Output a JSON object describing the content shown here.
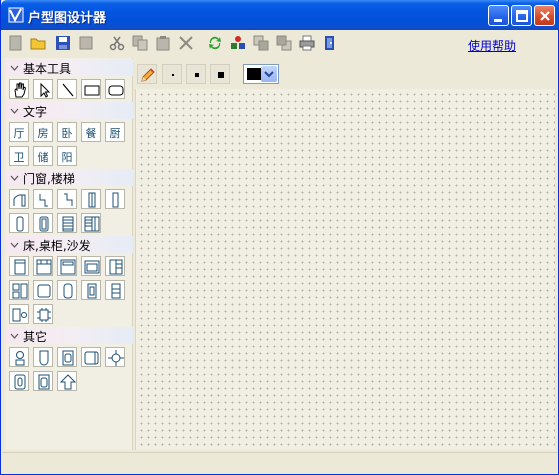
{
  "window": {
    "title": "户型图设计器"
  },
  "toolbar": {
    "buttons": [
      "new",
      "open",
      "save",
      "fullscreen",
      "cut",
      "copy",
      "paste",
      "delete",
      "refresh",
      "group",
      "bring-forward",
      "send-backward",
      "print",
      "exit"
    ],
    "help_label": "使用帮助"
  },
  "sidebar": {
    "sections": [
      {
        "title": "基本工具",
        "items": [
          "hand-icon",
          "pointer-icon",
          "line-icon",
          "rectangle-icon",
          "rounded-rectangle-icon"
        ]
      },
      {
        "title": "文字",
        "items": [
          "厅",
          "房",
          "卧",
          "餐",
          "厨",
          "卫",
          "储",
          "阳"
        ]
      },
      {
        "title": "门窗,楼梯",
        "items": [
          "door-icon",
          "door-left-icon",
          "door-right-icon",
          "window-icon",
          "window-thin-icon",
          "column-icon",
          "double-column-icon",
          "stairs-icon",
          "stairs-square-icon"
        ]
      },
      {
        "title": "床,桌柜,沙发",
        "items": [
          "cabinet-icon",
          "bed-icon",
          "sofa-icon",
          "wardrobe-icon",
          "bookshelf-icon",
          "drawer-icon",
          "table-icon",
          "chair-icon",
          "nightstand-icon",
          "shelf-icon",
          "dining-set-icon",
          "round-table-icon"
        ]
      },
      {
        "title": "其它",
        "items": [
          "toilet-icon",
          "bathtub-icon",
          "washbasin-icon",
          "sink-icon",
          "stove-icon",
          "fridge-icon",
          "washer-icon",
          "compass-arrow-icon"
        ]
      }
    ]
  },
  "canvas": {
    "tools": [
      "pencil-icon",
      "small-dot-icon",
      "medium-dot-icon",
      "large-dot-icon"
    ],
    "current_color": "#000000"
  },
  "colors": {
    "title_bar": "#0454e0",
    "help_link": "#0000cc",
    "chrome": "#ece9d8"
  }
}
